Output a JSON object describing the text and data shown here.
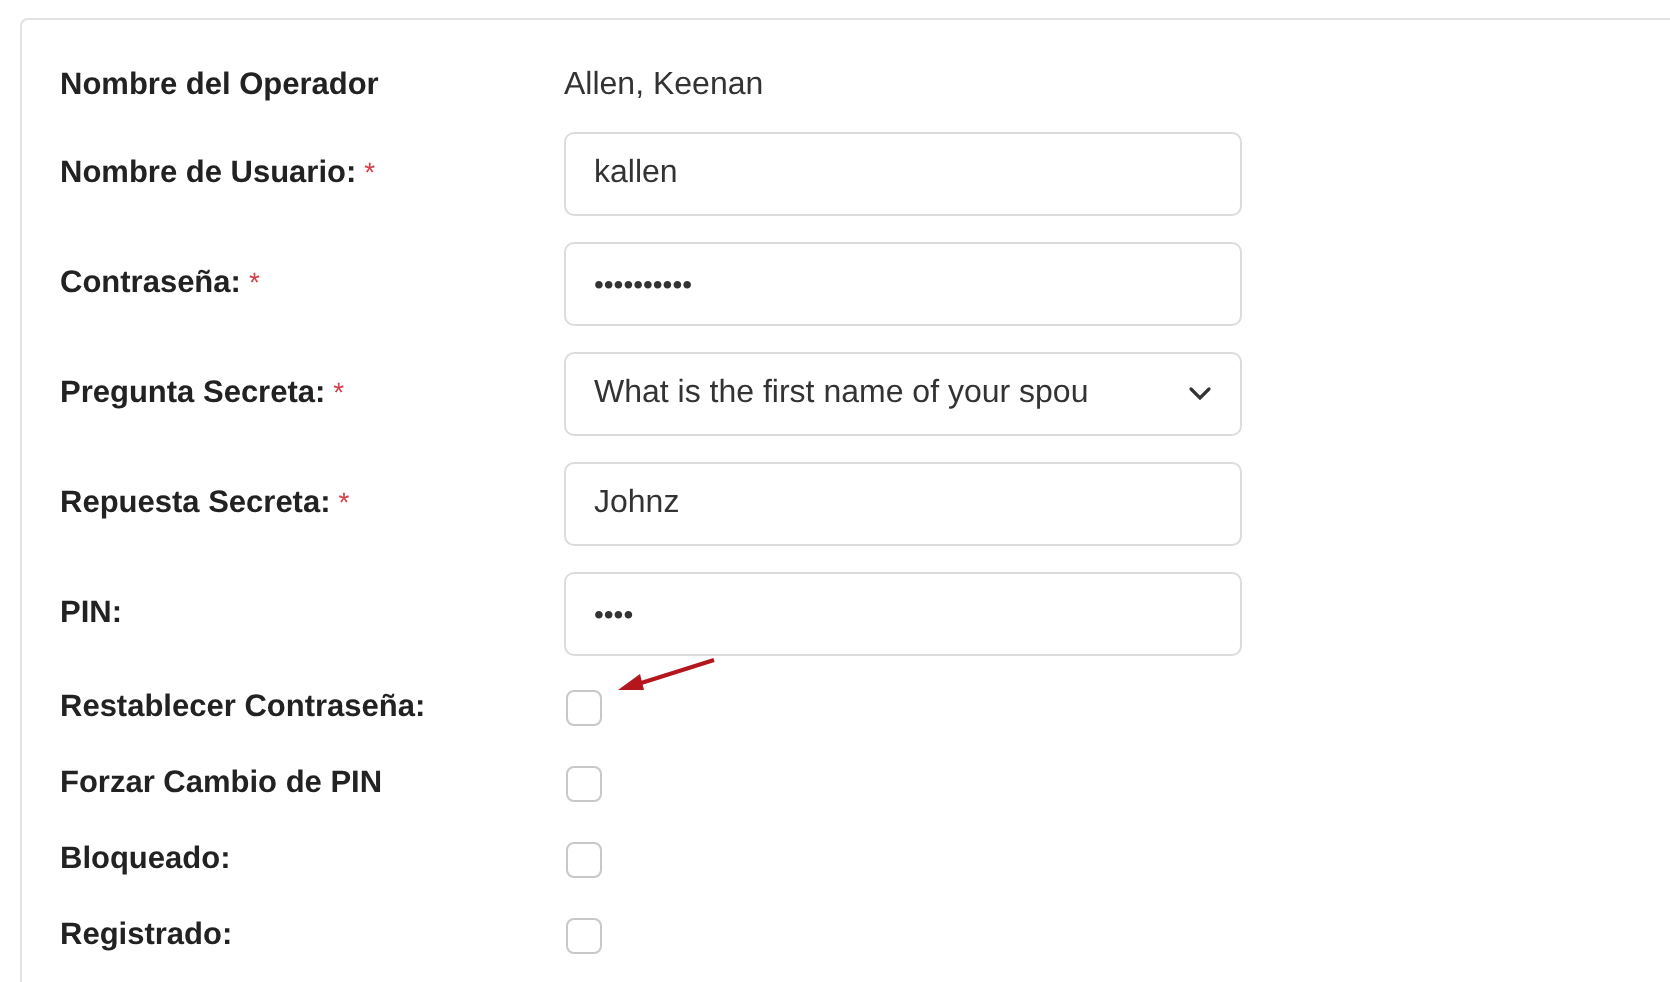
{
  "rows": [
    {
      "kind": "static",
      "label": "Nombre del Operador",
      "value": "Allen, Keenan"
    },
    {
      "kind": "text",
      "label": "Nombre de Usuario:",
      "required_mark": "*",
      "value": "kallen"
    },
    {
      "kind": "password",
      "label": "Contraseña:",
      "required_mark": "*",
      "value": "••••••••••"
    },
    {
      "kind": "select",
      "label": "Pregunta Secreta:",
      "required_mark": "*",
      "value": "What is the first name of your spou"
    },
    {
      "kind": "text",
      "label": "Repuesta Secreta:",
      "required_mark": "*",
      "value": "Johnz"
    },
    {
      "kind": "password",
      "label": "PIN:",
      "value": "••••"
    },
    {
      "kind": "checkbox",
      "label": "Restablecer Contraseña:",
      "checked": false,
      "highlighted": true
    },
    {
      "kind": "checkbox",
      "label": "Forzar Cambio de PIN",
      "checked": false,
      "highlighted": false
    },
    {
      "kind": "checkbox",
      "label": "Bloqueado:",
      "checked": false,
      "highlighted": false
    },
    {
      "kind": "checkbox",
      "label": "Registrado:",
      "checked": false,
      "highlighted": false
    }
  ]
}
